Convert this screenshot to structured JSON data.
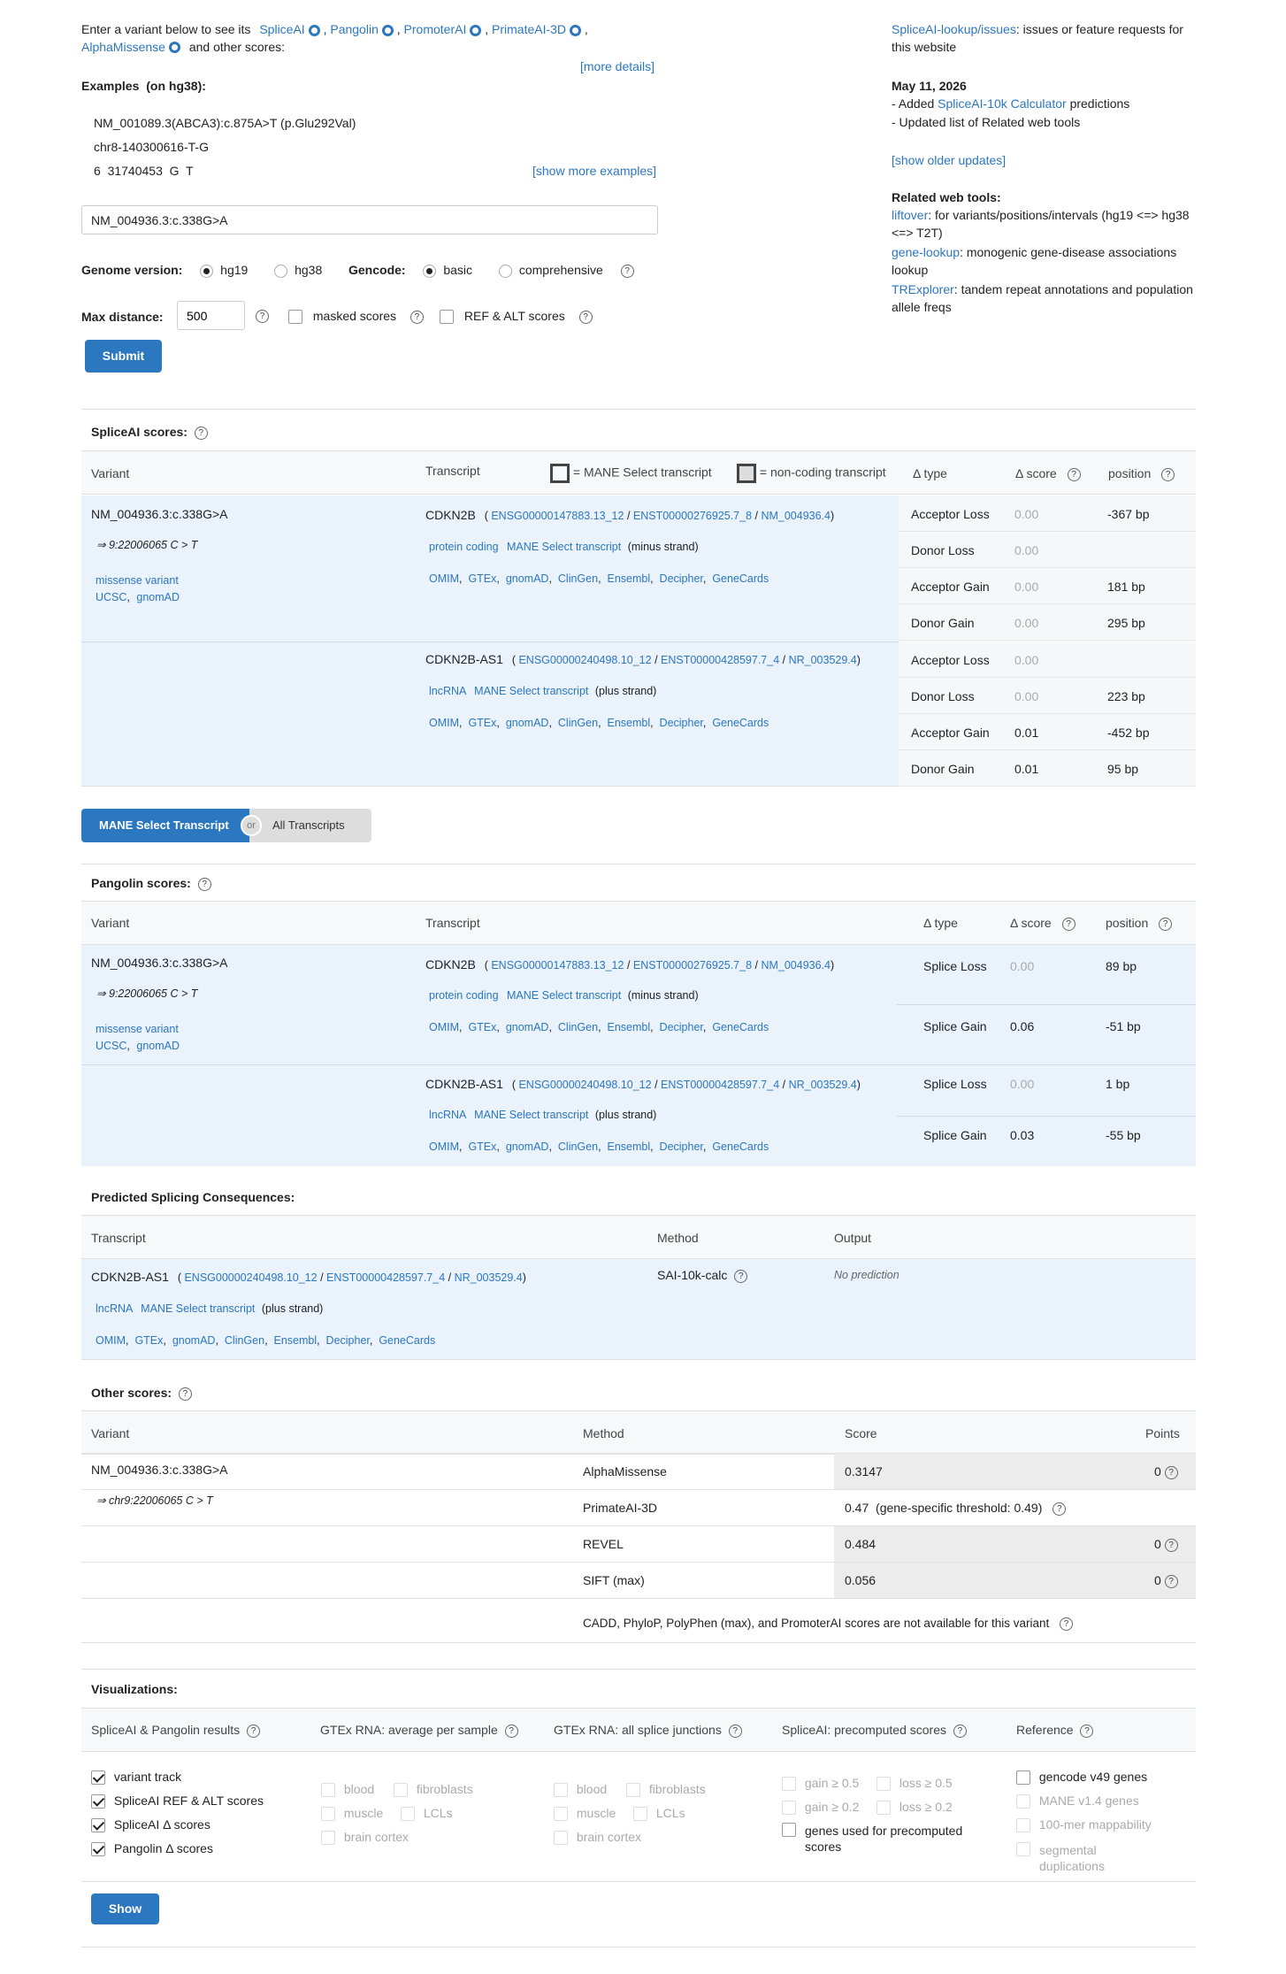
{
  "intro": {
    "enter_text": "Enter a variant below to see its",
    "spliceai": "SpliceAI",
    "pangolin": "Pangolin",
    "promoterai": "PromoterAI",
    "primateai": "PrimateAI-3D",
    "alphamissense": "AlphaMissense",
    "other_scores": "and other scores:",
    "more_details": "[more details]",
    "examples_label": "Examples",
    "examples_build": "(on hg38):",
    "examples": [
      "NM_001089.3(ABCA3):c.875A>T (p.Glu292Val)",
      "chr8-140300616-T-G",
      "6  31740453  G  T"
    ],
    "show_more": "[show more examples]"
  },
  "form": {
    "variant_value": "NM_004936.3:c.338G>A",
    "genome_label": "Genome version:",
    "hg19": "hg19",
    "hg38": "hg38",
    "gencode_label": "Gencode:",
    "basic": "basic",
    "comprehensive": "comprehensive",
    "maxdist_label": "Max distance:",
    "maxdist_value": "500",
    "masked": "masked scores",
    "refalt": "REF & ALT scores",
    "submit": "Submit"
  },
  "news": {
    "issues_link": "SpliceAI-lookup/issues",
    "issues_text": ": issues or feature requests for this website",
    "date": "May 11, 2026",
    "added_prefix": "- Added",
    "calc_link": "SpliceAI-10k Calculator",
    "added_suffix": "predictions",
    "updated": "- Updated list of Related web tools",
    "older": "[show older updates]",
    "related_title": "Related web tools:",
    "tools": [
      {
        "name": "liftover",
        "desc": ": for variants/positions/intervals (hg19 <=> hg38 <=> T2T)"
      },
      {
        "name": "gene-lookup",
        "desc": ": monogenic gene-disease associations lookup"
      },
      {
        "name": "TRExplorer",
        "desc": ": tandem repeat annotations and population allele freqs"
      }
    ]
  },
  "spliceai": {
    "title": "SpliceAI scores:",
    "col_variant": "Variant",
    "col_transcript": "Transcript",
    "legend_mane": "= MANE Select transcript",
    "legend_noncoding": "= non-coding transcript",
    "col_type": "Δ type",
    "col_score": "Δ score",
    "col_position": "position",
    "variant": "NM_004936.3:c.338G>A",
    "variant_arrow": "⇒ 9:22006065 C > T",
    "consequence": "missense variant",
    "ucsc": "UCSC",
    "gnomad": "gnomAD",
    "genes": [
      {
        "name": "CDKN2B",
        "ensg": "ENSG00000147883.13_12",
        "enst": "ENST00000276925.7_8",
        "nm": "NM_004936.4",
        "biotype": "protein coding",
        "mane": "MANE Select transcript",
        "strand": "(minus strand)",
        "links": [
          "OMIM",
          "GTEx",
          "gnomAD",
          "ClinGen",
          "Ensembl",
          "Decipher",
          "GeneCards"
        ],
        "rows": [
          {
            "type": "Acceptor Loss",
            "score": "0.00",
            "pos": "-367 bp"
          },
          {
            "type": "Donor Loss",
            "score": "0.00",
            "pos": ""
          },
          {
            "type": "Acceptor Gain",
            "score": "0.00",
            "pos": "181 bp"
          },
          {
            "type": "Donor Gain",
            "score": "0.00",
            "pos": "295 bp"
          }
        ]
      },
      {
        "name": "CDKN2B-AS1",
        "ensg": "ENSG00000240498.10_12",
        "enst": "ENST00000428597.7_4",
        "nm": "NR_003529.4",
        "biotype": "lncRNA",
        "mane": "MANE Select transcript",
        "strand": "(plus strand)",
        "links": [
          "OMIM",
          "GTEx",
          "gnomAD",
          "ClinGen",
          "Ensembl",
          "Decipher",
          "GeneCards"
        ],
        "rows": [
          {
            "type": "Acceptor Loss",
            "score": "0.00",
            "pos": ""
          },
          {
            "type": "Donor Loss",
            "score": "0.00",
            "pos": "223 bp"
          },
          {
            "type": "Acceptor Gain",
            "score": "0.01",
            "pos": "-452 bp"
          },
          {
            "type": "Donor Gain",
            "score": "0.01",
            "pos": "95 bp"
          }
        ]
      }
    ]
  },
  "toggle": {
    "mane": "MANE Select Transcript",
    "or": "or",
    "all": "All Transcripts"
  },
  "pangolin": {
    "title": "Pangolin scores:",
    "col_variant": "Variant",
    "col_transcript": "Transcript",
    "col_type": "Δ type",
    "col_score": "Δ score",
    "col_position": "position",
    "variant": "NM_004936.3:c.338G>A",
    "variant_arrow": "⇒ 9:22006065 C > T",
    "consequence": "missense variant",
    "ucsc": "UCSC",
    "gnomad": "gnomAD",
    "rows": [
      {
        "type": "Splice Loss",
        "score": "0.00",
        "pos": "89 bp"
      },
      {
        "type": "Splice Gain",
        "score": "0.06",
        "pos": "-51 bp"
      },
      {
        "type": "Splice Loss",
        "score": "0.00",
        "pos": "1 bp"
      },
      {
        "type": "Splice Gain",
        "score": "0.03",
        "pos": "-55 bp"
      }
    ]
  },
  "predicted": {
    "title": "Predicted Splicing Consequences:",
    "col_transcript": "Transcript",
    "col_method": "Method",
    "col_output": "Output",
    "gene": "CDKN2B-AS1",
    "ensg": "ENSG00000240498.10_12",
    "enst": "ENST00000428597.7_4",
    "nm": "NR_003529.4",
    "biotype": "lncRNA",
    "mane": "MANE Select transcript",
    "strand": "(plus strand)",
    "method": "SAI-10k-calc",
    "output": "No prediction"
  },
  "other": {
    "title": "Other scores:",
    "col_variant": "Variant",
    "col_method": "Method",
    "col_score": "Score",
    "col_points": "Points",
    "variant": "NM_004936.3:c.338G>A",
    "variant_arrow": "⇒ chr9:22006065 C > T",
    "rows": [
      {
        "method": "AlphaMissense",
        "score": "0.3147",
        "points": "0"
      },
      {
        "method": "PrimateAI-3D",
        "score": "0.47  (gene-specific threshold: 0.49)",
        "points": ""
      },
      {
        "method": "REVEL",
        "score": "0.484",
        "points": "0"
      },
      {
        "method": "SIFT (max)",
        "score": "0.056",
        "points": "0"
      }
    ],
    "note": "CADD,  PhyloP,  PolyPhen (max),  and PromoterAI scores are not available for this variant"
  },
  "viz": {
    "title": "Visualizations:",
    "col1": "SpliceAI & Pangolin results",
    "col2": "GTEx RNA: average per sample",
    "col3": "GTEx RNA: all splice junctions",
    "col4": "SpliceAI: precomputed scores",
    "col5": "Reference",
    "c1": [
      "variant track",
      "SpliceAI REF & ALT scores",
      "SpliceAI Δ  scores",
      "Pangolin Δ  scores"
    ],
    "tissues": [
      "blood",
      "fibroblasts",
      "muscle",
      "LCLs",
      "brain cortex"
    ],
    "pre": [
      "gain ≥ 0.5",
      "loss ≥ 0.5",
      "gain ≥ 0.2",
      "loss ≥ 0.2",
      "genes used for precomputed scores"
    ],
    "ref": [
      "gencode v49 genes",
      "MANE v1.4 genes",
      "100-mer mappability",
      "segmental duplications"
    ],
    "show": "Show"
  }
}
